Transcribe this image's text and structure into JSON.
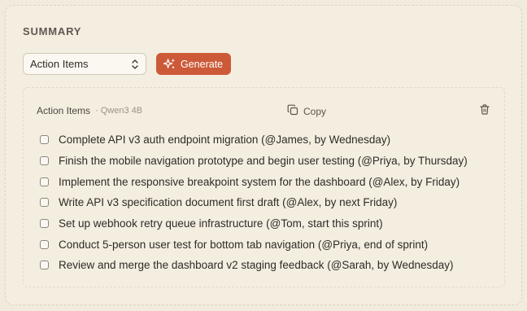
{
  "summary": {
    "heading": "SUMMARY",
    "select": {
      "value": "Action Items"
    },
    "generate_label": "Generate",
    "card": {
      "title": "Action Items",
      "separator": "·",
      "model": "Qwen3 4B",
      "copy_label": "Copy",
      "items": [
        "Complete API v3 auth endpoint migration (@James, by Wednesday)",
        "Finish the mobile navigation prototype and begin user testing (@Priya, by Thursday)",
        "Implement the responsive breakpoint system for the dashboard (@Alex, by Friday)",
        "Write API v3 specification document first draft (@Alex, by next Friday)",
        "Set up webhook retry queue infrastructure (@Tom, start this sprint)",
        "Conduct 5-person user test for bottom tab navigation (@Priya, end of sprint)",
        "Review and merge the dashboard v2 staging feedback (@Sarah, by Wednesday)"
      ]
    }
  },
  "colors": {
    "background": "#f1ebdd",
    "accent": "#cc5a38"
  },
  "icons": {
    "select_chevron": "chevron-up-down-icon",
    "generate": "sparkles-icon",
    "copy": "copy-icon",
    "delete": "trash-icon"
  }
}
